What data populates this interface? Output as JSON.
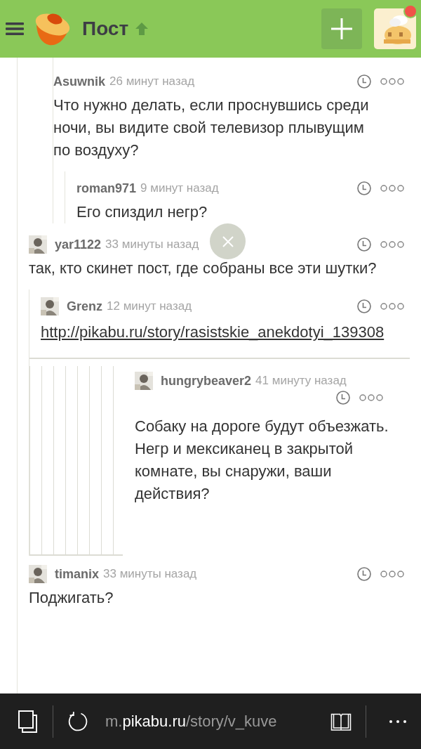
{
  "header": {
    "title": "Пост",
    "notification": true
  },
  "comments": [
    {
      "author": "Asuwnik",
      "time": "26 минут назад",
      "avatar": false,
      "text": "Что нужно делать, если проснувшись среди ночи, вы видите свой телевизор плывущим по воздуху?",
      "children": [
        {
          "author": "roman971",
          "time": "9 минут назад",
          "avatar": false,
          "text": "Его спиздил негр?"
        }
      ]
    },
    {
      "author": "yar1122",
      "time": "33 минуты назад",
      "avatar": true,
      "text": "так, кто скинет пост, где собраны все эти шутки?",
      "children": [
        {
          "author": "Grenz",
          "time": "12 минут назад",
          "avatar": true,
          "link": "http://pikabu.ru/story/rasistskie_anekdotyi_139308",
          "children": [
            {
              "author": "hungrybeaver2",
              "time": "41 минуту назад",
              "avatar": true,
              "text": "Собаку на дороге будут объезжать.\nНегр и мексиканец в закрытой комнате, вы снаружи, ваши действия?"
            }
          ]
        }
      ]
    },
    {
      "author": "timanix",
      "time": "33 минуты назад",
      "avatar": true,
      "text": "Поджигать?"
    }
  ],
  "address_bar": {
    "prefix": "m.",
    "domain": "pikabu.ru",
    "path": "/story/v_kuve"
  }
}
